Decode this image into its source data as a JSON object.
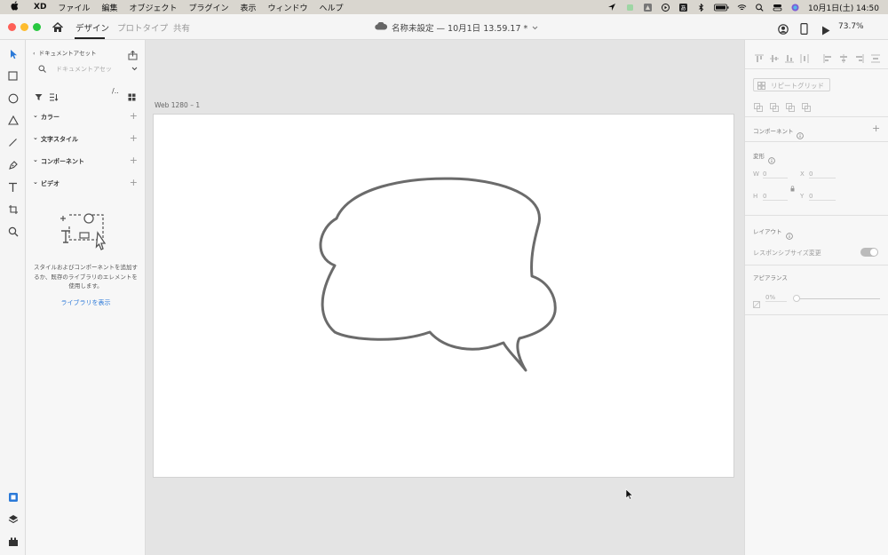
{
  "menubar": {
    "app": "XD",
    "items": [
      "ファイル",
      "編集",
      "オブジェクト",
      "プラグイン",
      "表示",
      "ウィンドウ",
      "ヘルプ"
    ],
    "datetime": "10月1日(土)  14:50"
  },
  "titlebar": {
    "tabs": [
      "デザイン",
      "プロトタイプ",
      "共有"
    ],
    "document_title": "名称未設定 — 10月1日 13.59.17 *",
    "zoom": "73.7%"
  },
  "assets": {
    "header": "ドキュメントアセット",
    "search_placeholder": "ドキュメントアセッ",
    "sections": [
      "カラー",
      "文字スタイル",
      "コンポーネント",
      "ビデオ"
    ],
    "empty_message": "スタイルおよびコンポーネントを追加するか、既存のライブラリのエレメントを使用します。",
    "library_link": "ライブラリを表示"
  },
  "canvas": {
    "artboard_name": "Web 1280 – 1"
  },
  "props": {
    "repeat_grid": "リピートグリッド",
    "component_label": "コンポーネント",
    "transform_label": "変形",
    "w_label": "W",
    "w_value": "0",
    "h_label": "H",
    "h_value": "0",
    "x_label": "X",
    "x_value": "0",
    "y_label": "Y",
    "y_value": "0",
    "layout_label": "レイアウト",
    "responsive_label": "レスポンシブサイズ変更",
    "appearance_label": "アピアランス",
    "opacity": "0%"
  },
  "colors": {
    "accent": "#2c7ad8",
    "shape_stroke": "#6b6b6b"
  }
}
